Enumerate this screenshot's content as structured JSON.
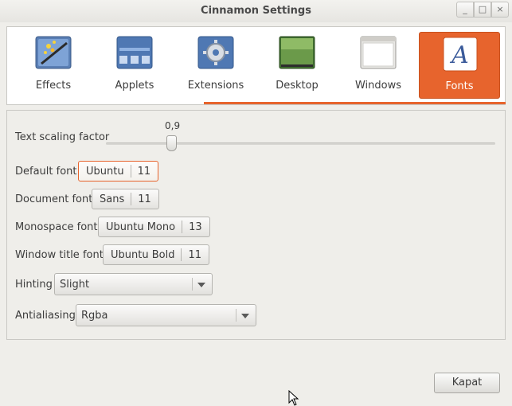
{
  "window": {
    "title": "Cinnamon Settings",
    "controls": {
      "minimize": "_",
      "maximize": "□",
      "close": "×"
    }
  },
  "modules": [
    {
      "label": "Effects",
      "icon": "effects-icon",
      "active": false
    },
    {
      "label": "Applets",
      "icon": "applets-icon",
      "active": false
    },
    {
      "label": "Extensions",
      "icon": "extensions-icon",
      "active": false
    },
    {
      "label": "Desktop",
      "icon": "desktop-icon",
      "active": false
    },
    {
      "label": "Windows",
      "icon": "windows-icon",
      "active": false
    },
    {
      "label": "Fonts",
      "icon": "fonts-icon",
      "active": true
    }
  ],
  "accent_color": "#e7642d",
  "fonts": {
    "text_scaling": {
      "label": "Text scaling factor",
      "value": "0,9"
    },
    "default_font": {
      "label": "Default font",
      "name": "Ubuntu",
      "size": "11"
    },
    "document_font": {
      "label": "Document font",
      "name": "Sans",
      "size": "11"
    },
    "monospace_font": {
      "label": "Monospace font",
      "name": "Ubuntu Mono",
      "size": "13"
    },
    "window_title_font": {
      "label": "Window title font",
      "name": "Ubuntu Bold",
      "size": "11"
    },
    "hinting": {
      "label": "Hinting",
      "value": "Slight"
    },
    "antialiasing": {
      "label": "Antialiasing",
      "value": "Rgba"
    }
  },
  "footer": {
    "close_label": "Kapat"
  }
}
